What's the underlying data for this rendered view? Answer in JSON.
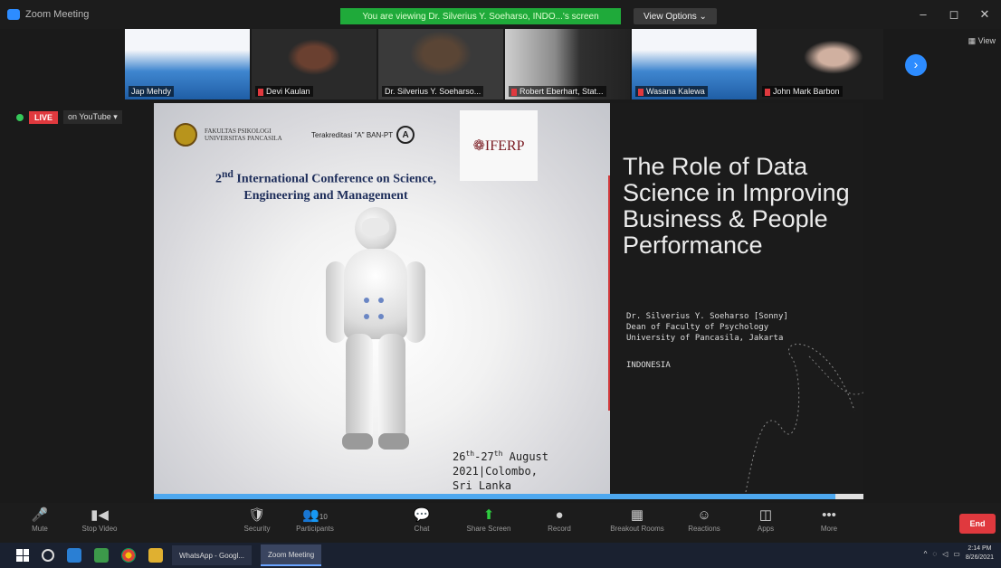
{
  "window": {
    "title": "Zoom Meeting",
    "share_banner": "You are viewing Dr. Silverius Y. Soeharso, INDO...'s screen",
    "view_options": "View Options ⌄",
    "controls": {
      "minimize": "–",
      "maximize": "◻",
      "close": "✕"
    }
  },
  "thumbnails": [
    {
      "name": "Jap Mehdy",
      "muted": false
    },
    {
      "name": "Devi Kaulan",
      "muted": true
    },
    {
      "name": "Dr. Silverius Y. Soeharso...",
      "muted": false
    },
    {
      "name": "Robert Eberhart, Stat...",
      "muted": true
    },
    {
      "name": "Wasana Kalewa",
      "muted": true
    },
    {
      "name": "John Mark Barbon",
      "muted": true
    }
  ],
  "view_corner": "▦ View",
  "live": {
    "badge": "LIVE",
    "platform": "on YouTube ▾"
  },
  "slide": {
    "logo_text": "FAKULTAS PSIKOLOGI UNIVERSITAS PANCASILA",
    "accreditation": "Terakreditasi \"A\" BAN-PT",
    "accreditation_grade": "A",
    "iferp": "❁IFERP",
    "conference_title_sup": "nd",
    "conference_title_num": "2",
    "conference_title": "International Conference on Science, Engineering and Management",
    "date_line1_a": "26",
    "date_line1_sup1": "th",
    "date_line1_b": "-27",
    "date_line1_sup2": "th",
    "date_line1_c": " August",
    "date_line2": "2021|Colombo,",
    "date_line3": "Sri Lanka",
    "talk_title": "The Role of Data Science in Improving Business & People Performance",
    "speaker_line1": "Dr. Silverius Y. Soeharso [Sonny]",
    "speaker_line2": "Dean of Faculty of Psychology",
    "speaker_line3": "University of Pancasila, Jakarta",
    "country": "INDONESIA",
    "progress": 0.96
  },
  "toolbar": {
    "items": [
      {
        "label": "Mute",
        "icon": "🎤"
      },
      {
        "label": "Stop Video",
        "icon": "▮◀"
      },
      {
        "label": "Security",
        "icon": "🛡"
      },
      {
        "label": "Participants",
        "icon": "👥"
      },
      {
        "label": "Chat",
        "icon": "💬"
      },
      {
        "label": "Share Screen",
        "icon": "⬆"
      },
      {
        "label": "Record",
        "icon": "●"
      },
      {
        "label": "Breakout Rooms",
        "icon": "▦"
      },
      {
        "label": "Reactions",
        "icon": "☺"
      },
      {
        "label": "Apps",
        "icon": "◫"
      },
      {
        "label": "More",
        "icon": "•••"
      }
    ],
    "participants_count": "10",
    "end_label": "End"
  },
  "taskbar": {
    "apps": [
      {
        "label": "WhatsApp - Googl..."
      },
      {
        "label": "Zoom Meeting"
      }
    ],
    "time": "2:14 PM",
    "date": "8/26/2021"
  },
  "colors": {
    "accent": "#2d8cff",
    "banner": "#1faa3a",
    "live": "#e0393e",
    "end": "#e0393e"
  }
}
